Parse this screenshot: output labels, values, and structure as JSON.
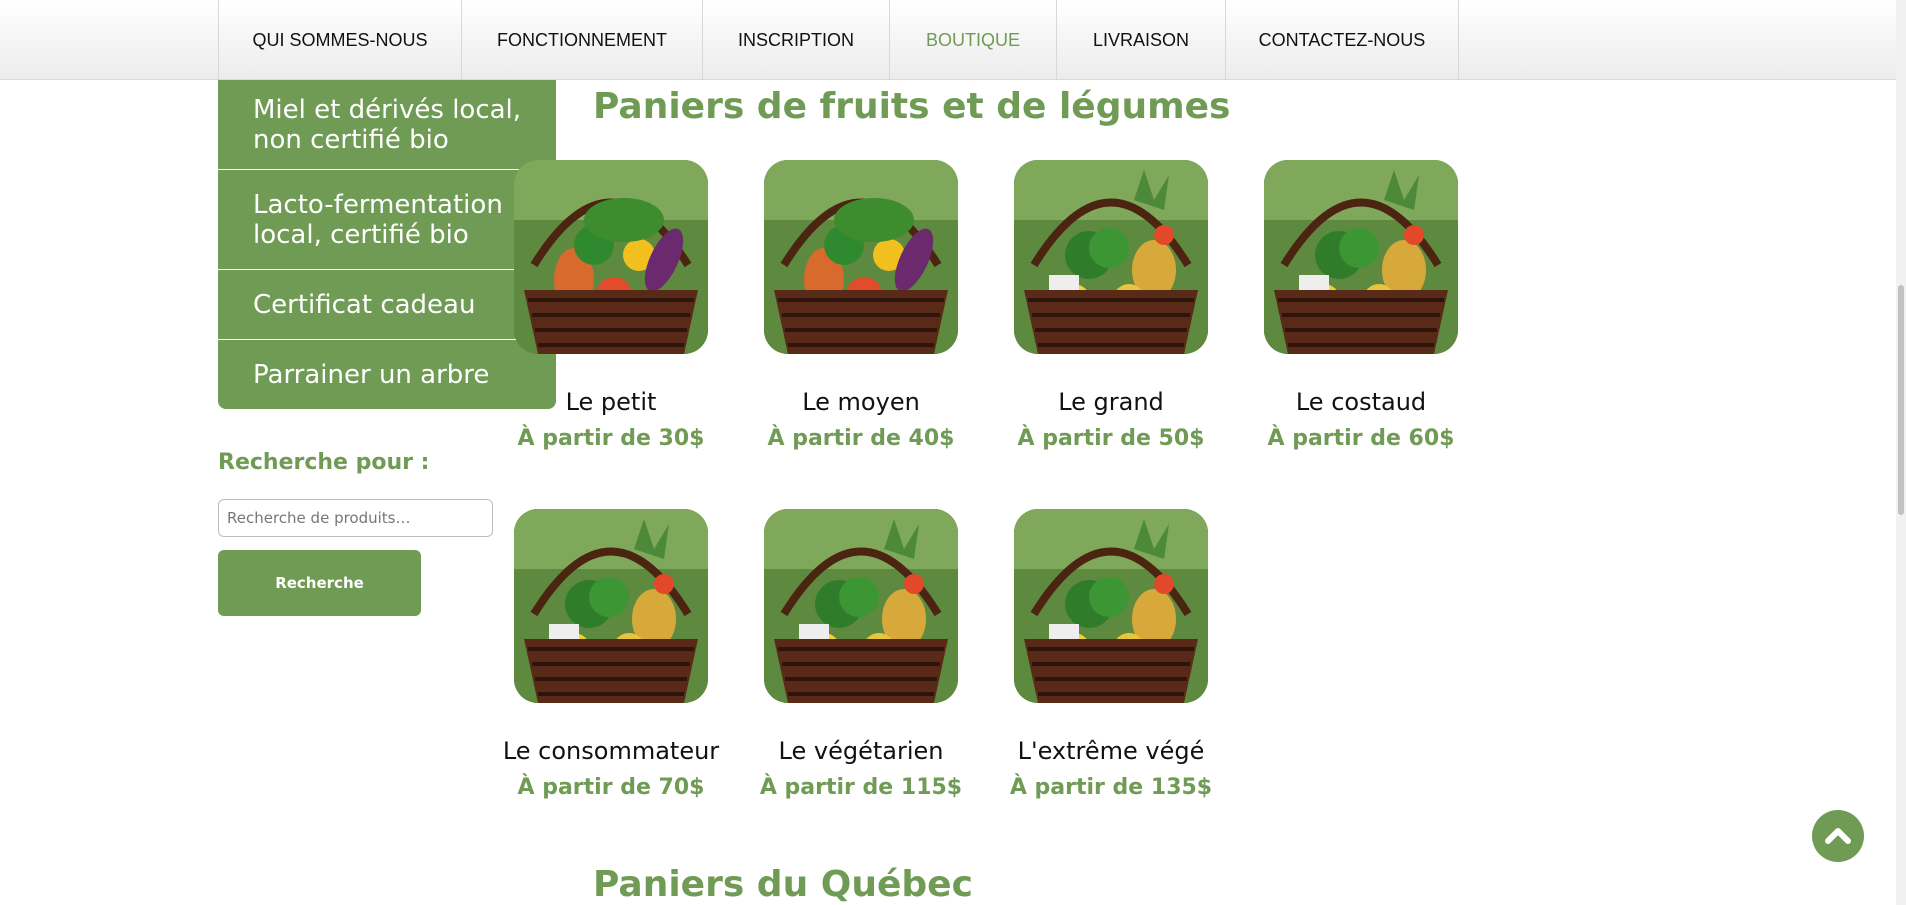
{
  "nav": {
    "items": [
      {
        "label": "QUI SOMMES-NOUS"
      },
      {
        "label": "FONCTIONNEMENT"
      },
      {
        "label": "INSCRIPTION"
      },
      {
        "label": "BOUTIQUE",
        "active": true
      },
      {
        "label": "LIVRAISON"
      },
      {
        "label": "CONTACTEZ-NOUS"
      }
    ]
  },
  "sidebar": {
    "items": [
      {
        "label": "Miel et dérivés local, non certifié bio"
      },
      {
        "label": "Lacto-fermentation local, certifié bio"
      },
      {
        "label": "Certificat cadeau"
      },
      {
        "label": "Parrainer un arbre"
      }
    ],
    "search_title": "Recherche pour :",
    "search_placeholder": "Recherche de produits…",
    "search_button": "Recherche"
  },
  "main": {
    "section_title": "Paniers de fruits et de légumes",
    "next_section_title": "Paniers du Québec",
    "products": [
      {
        "name": "Le petit",
        "price": "À partir de 30$",
        "image": "vegetable-basket-small"
      },
      {
        "name": "Le moyen",
        "price": "À partir de 40$",
        "image": "vegetable-basket-medium"
      },
      {
        "name": "Le grand",
        "price": "À partir de 50$",
        "image": "fruit-vegetable-basket"
      },
      {
        "name": "Le costaud",
        "price": "À partir de 60$",
        "image": "fruit-vegetable-basket"
      },
      {
        "name": "Le consommateur",
        "price": "À partir de 70$",
        "image": "fruit-vegetable-basket"
      },
      {
        "name": "Le végétarien",
        "price": "À partir de 115$",
        "image": "fruit-vegetable-basket"
      },
      {
        "name": "L'extrême végé",
        "price": "À partir de 135$",
        "image": "fruit-vegetable-basket"
      }
    ]
  },
  "colors": {
    "accent": "#6f9b55",
    "text": "#111111"
  },
  "icons": {
    "back_to_top": "chevron-up-icon"
  }
}
